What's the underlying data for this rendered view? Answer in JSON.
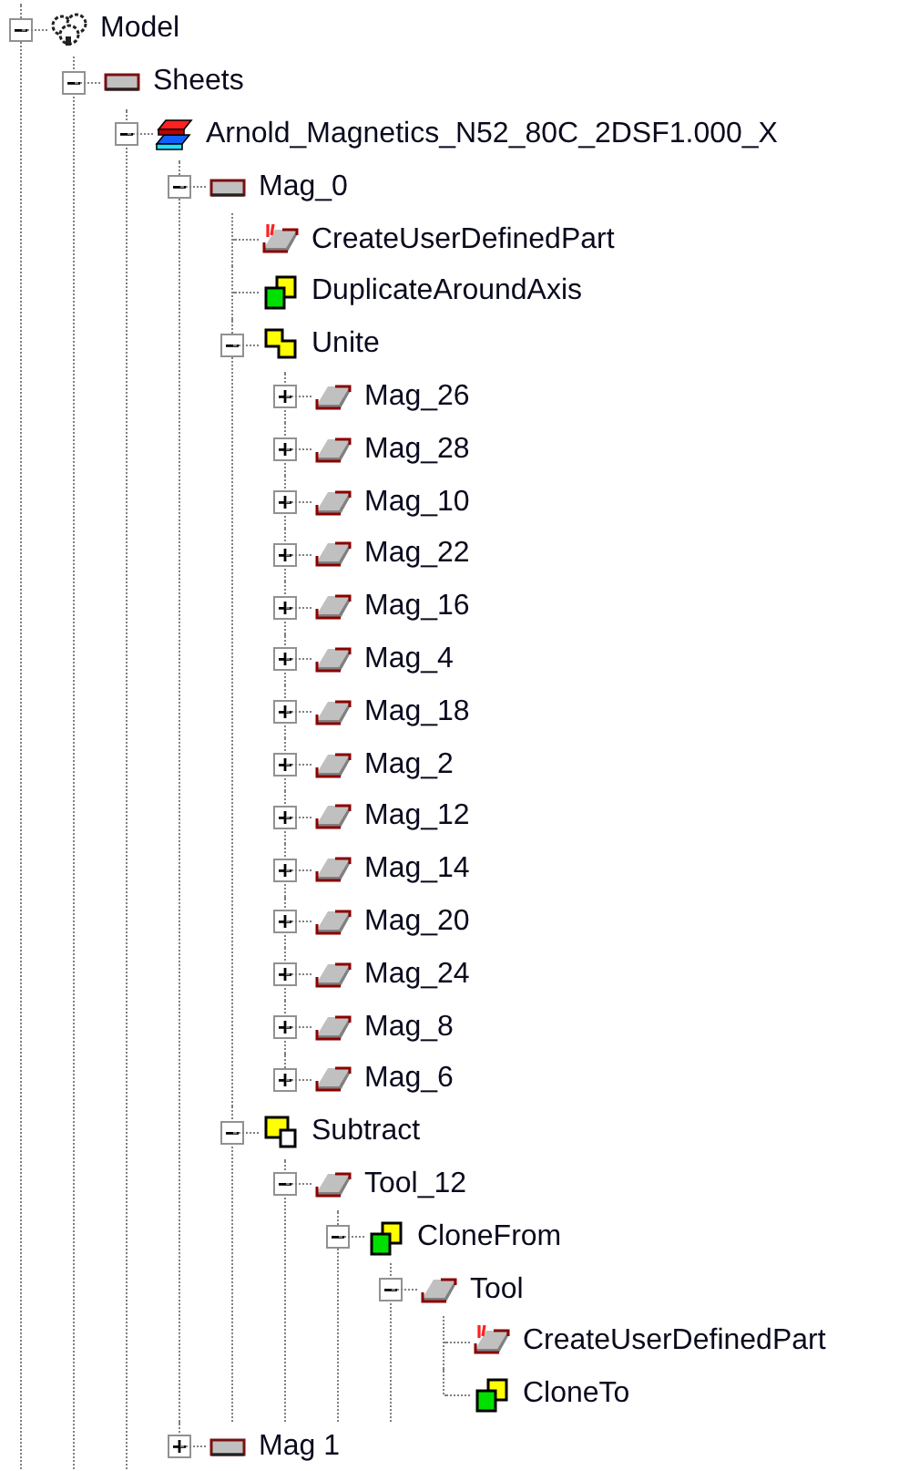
{
  "tree": [
    {
      "label": "Model",
      "kind": "model",
      "expanded": true,
      "children": [
        {
          "label": "Sheets",
          "kind": "sheet",
          "expanded": true,
          "children": [
            {
              "label": "Arnold_Magnetics_N52_80C_2DSF1.000_X",
              "kind": "magnet",
              "expanded": true,
              "children": [
                {
                  "label": "Mag_0",
                  "kind": "sheet",
                  "expanded": true,
                  "children": [
                    {
                      "label": "CreateUserDefinedPart",
                      "kind": "udp"
                    },
                    {
                      "label": "DuplicateAroundAxis",
                      "kind": "duplicate"
                    },
                    {
                      "label": "Unite",
                      "kind": "unite",
                      "expanded": true,
                      "children": [
                        {
                          "label": "Mag_26",
                          "kind": "body",
                          "expanded": false
                        },
                        {
                          "label": "Mag_28",
                          "kind": "body",
                          "expanded": false
                        },
                        {
                          "label": "Mag_10",
                          "kind": "body",
                          "expanded": false
                        },
                        {
                          "label": "Mag_22",
                          "kind": "body",
                          "expanded": false
                        },
                        {
                          "label": "Mag_16",
                          "kind": "body",
                          "expanded": false
                        },
                        {
                          "label": "Mag_4",
                          "kind": "body",
                          "expanded": false
                        },
                        {
                          "label": "Mag_18",
                          "kind": "body",
                          "expanded": false
                        },
                        {
                          "label": "Mag_2",
                          "kind": "body",
                          "expanded": false
                        },
                        {
                          "label": "Mag_12",
                          "kind": "body",
                          "expanded": false
                        },
                        {
                          "label": "Mag_14",
                          "kind": "body",
                          "expanded": false
                        },
                        {
                          "label": "Mag_20",
                          "kind": "body",
                          "expanded": false
                        },
                        {
                          "label": "Mag_24",
                          "kind": "body",
                          "expanded": false
                        },
                        {
                          "label": "Mag_8",
                          "kind": "body",
                          "expanded": false
                        },
                        {
                          "label": "Mag_6",
                          "kind": "body",
                          "expanded": false
                        }
                      ]
                    },
                    {
                      "label": "Subtract",
                      "kind": "subtract",
                      "expanded": true,
                      "children": [
                        {
                          "label": "Tool_12",
                          "kind": "body",
                          "expanded": true,
                          "children": [
                            {
                              "label": "CloneFrom",
                              "kind": "duplicate",
                              "expanded": true,
                              "children": [
                                {
                                  "label": "Tool",
                                  "kind": "body",
                                  "expanded": true,
                                  "children": [
                                    {
                                      "label": "CreateUserDefinedPart",
                                      "kind": "udp"
                                    },
                                    {
                                      "label": "CloneTo",
                                      "kind": "duplicate"
                                    }
                                  ]
                                }
                              ]
                            }
                          ]
                        }
                      ]
                    }
                  ]
                },
                {
                  "label": "Mag 1",
                  "kind": "sheet",
                  "expanded": false
                }
              ]
            }
          ]
        }
      ]
    }
  ]
}
